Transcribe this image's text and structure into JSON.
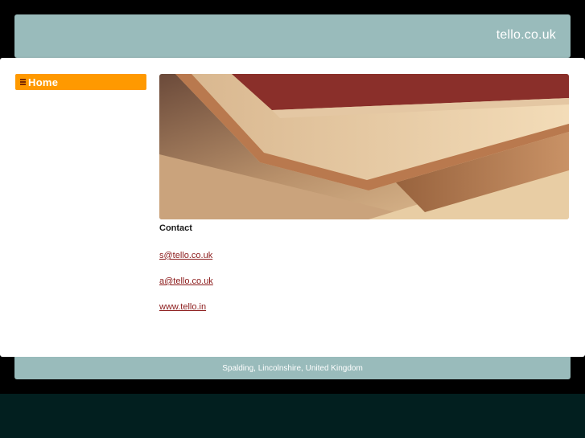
{
  "header": {
    "site_title": "tello.co.uk"
  },
  "nav": {
    "items": [
      {
        "label": "Home",
        "icon": "list-icon",
        "color": "#ff9900"
      }
    ]
  },
  "hero": {
    "image": "open-books-photo"
  },
  "content": {
    "heading": "Contact",
    "links": [
      "s@tello.co.uk",
      "a@tello.co.uk",
      "www.tello.in"
    ]
  },
  "footer": {
    "text": "Spalding, Lincolnshire, United Kingdom"
  },
  "colors": {
    "header_bg": "#99bbbb",
    "accent": "#ff9900",
    "link": "#8b1a1a",
    "page_bg": "#000000",
    "bottom_band": "#021f1f"
  }
}
